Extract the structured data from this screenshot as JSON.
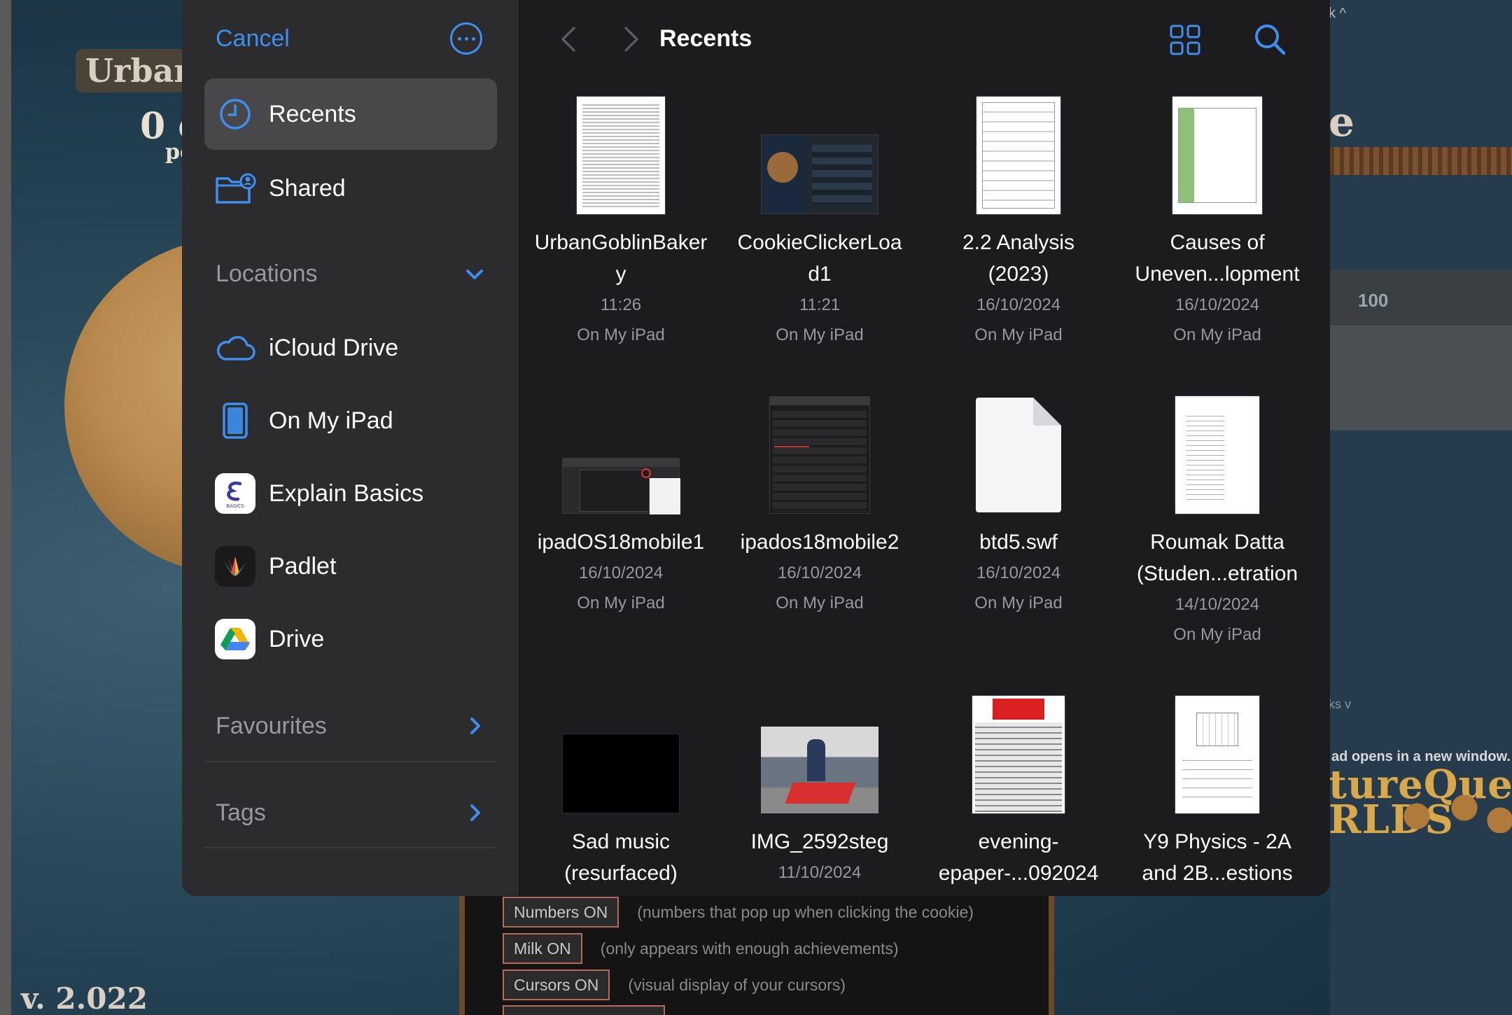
{
  "background_game": {
    "title": "Urban G",
    "count": "0 c",
    "count_sub": "pe",
    "version": "v. 2.022",
    "right_letter": "e",
    "right_number": "100",
    "right_top_text": "k ^",
    "right_ks_text": "ks v",
    "ad_text": "ad opens in a new window.",
    "ad_logo_line1": "tureQuest",
    "ad_logo_line2": "RLDS",
    "options": [
      {
        "label": "Numbers ON",
        "desc": "(numbers that pop up when clicking the cookie)"
      },
      {
        "label": "Milk ON",
        "desc": "(only appears with enough achievements)"
      },
      {
        "label": "Cursors ON",
        "desc": "(visual display of your cursors)"
      }
    ]
  },
  "picker": {
    "cancel_label": "Cancel",
    "title": "Recents",
    "sidebar": {
      "top_items": [
        {
          "label": "Recents",
          "icon": "clock-icon",
          "selected": true
        },
        {
          "label": "Shared",
          "icon": "shared-folder-icon",
          "selected": false
        }
      ],
      "locations_header": "Locations",
      "locations": [
        {
          "label": "iCloud Drive",
          "icon": "cloud-icon"
        },
        {
          "label": "On My iPad",
          "icon": "ipad-icon"
        },
        {
          "label": "Explain Basics",
          "icon": "explain-basics-icon"
        },
        {
          "label": "Padlet",
          "icon": "padlet-icon"
        },
        {
          "label": "Drive",
          "icon": "google-drive-icon"
        }
      ],
      "favourites_header": "Favourites",
      "tags_header": "Tags"
    },
    "files": [
      {
        "name": "UrbanGoblinBakery",
        "name_lines": [
          "UrbanGoblinBaker",
          "y"
        ],
        "date": "11:26",
        "location": "On My iPad"
      },
      {
        "name": "CookieClickerLoad1",
        "name_lines": [
          "CookieClickerLoa",
          "d1"
        ],
        "date": "11:21",
        "location": "On My iPad"
      },
      {
        "name": "2.2 Analysis (2023)",
        "name_lines": [
          "2.2 Analysis",
          "(2023)"
        ],
        "date": "16/10/2024",
        "location": "On My iPad"
      },
      {
        "name": "Causes of Uneven...lopment",
        "name_lines": [
          "Causes of",
          "Uneven...lopment"
        ],
        "date": "16/10/2024",
        "location": "On My iPad"
      },
      {
        "name": "ipadOS18mobile1",
        "name_lines": [
          "ipadOS18mobile1"
        ],
        "date": "16/10/2024",
        "location": "On My iPad"
      },
      {
        "name": "ipados18mobile2",
        "name_lines": [
          "ipados18mobile2"
        ],
        "date": "16/10/2024",
        "location": "On My iPad"
      },
      {
        "name": "btd5.swf",
        "name_lines": [
          "btd5.swf"
        ],
        "date": "16/10/2024",
        "location": "On My iPad"
      },
      {
        "name": "Roumak Datta (Studen...etration",
        "name_lines": [
          "Roumak Datta",
          "(Studen...etration"
        ],
        "date": "14/10/2024",
        "location": "On My iPad"
      },
      {
        "name": "Sad music (resurfaced)",
        "name_lines": [
          "Sad music",
          "(resurfaced)"
        ],
        "date": "",
        "location": ""
      },
      {
        "name": "IMG_2592steg",
        "name_lines": [
          "IMG_2592steg"
        ],
        "date": "11/10/2024",
        "location": ""
      },
      {
        "name": "evening-epaper-...092024",
        "name_lines": [
          "evening-",
          "epaper-...092024"
        ],
        "date": "",
        "location": ""
      },
      {
        "name": "Y9 Physics - 2A and 2B...estions",
        "name_lines": [
          "Y9 Physics - 2A",
          "and 2B...estions"
        ],
        "date": "",
        "location": ""
      }
    ]
  },
  "colors": {
    "accent": "#3d8ff0",
    "sidebar_bg": "#2c2c2e",
    "main_bg": "#1c1c1e",
    "selected_bg": "#48484a",
    "secondary_text": "#98989d"
  }
}
